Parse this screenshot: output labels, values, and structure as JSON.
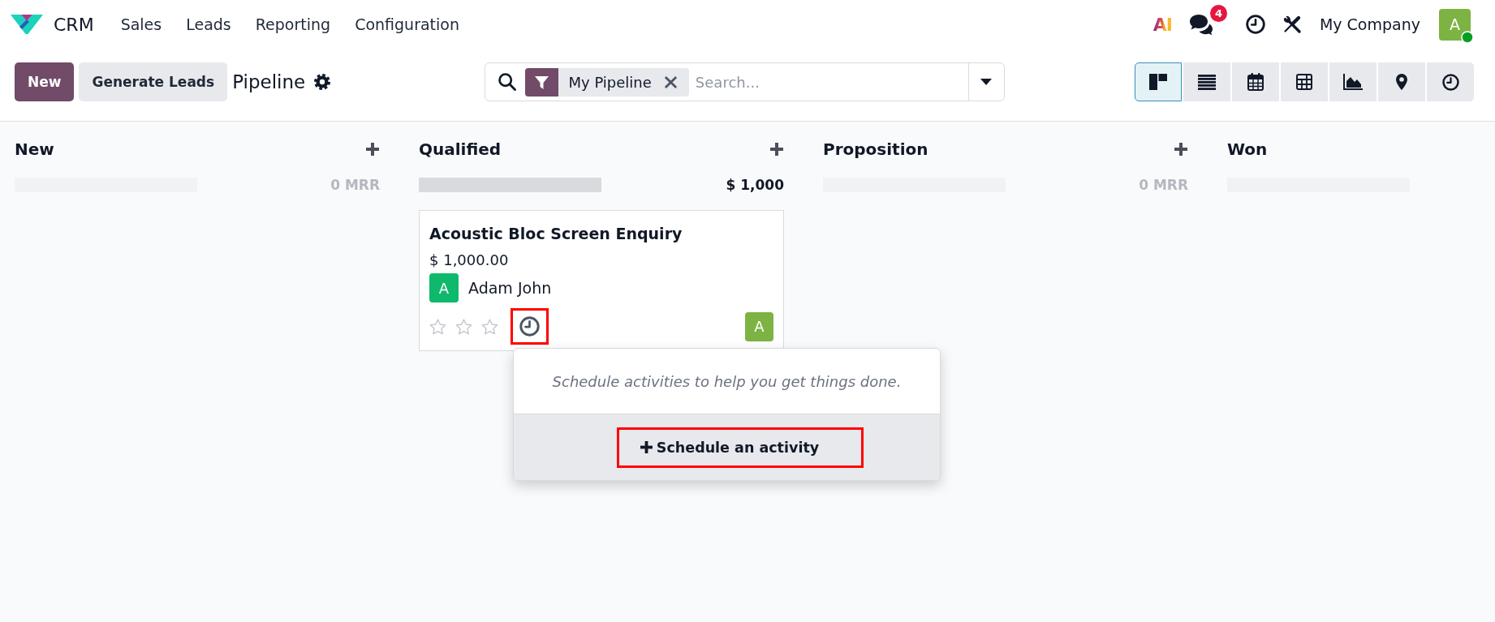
{
  "navbar": {
    "app_name": "CRM",
    "menu": [
      {
        "label": "Sales"
      },
      {
        "label": "Leads"
      },
      {
        "label": "Reporting"
      },
      {
        "label": "Configuration"
      }
    ],
    "ai_label": "AI",
    "message_count": "4",
    "company": "My Company",
    "user_initial": "A",
    "user_online": true
  },
  "control_panel": {
    "buttons": [
      {
        "label": "New",
        "kind": "primary"
      },
      {
        "label": "Generate Leads",
        "kind": "secondary"
      }
    ],
    "title": "Pipeline"
  },
  "search": {
    "facets": [
      {
        "kind": "filter",
        "label": "My Pipeline"
      }
    ],
    "placeholder": "Search..."
  },
  "views": [
    {
      "kind": "kanban",
      "selected": true
    },
    {
      "kind": "list",
      "selected": false
    },
    {
      "kind": "calendar",
      "selected": false
    },
    {
      "kind": "pivot",
      "selected": false
    },
    {
      "kind": "graph",
      "selected": false
    },
    {
      "kind": "map",
      "selected": false
    },
    {
      "kind": "activity",
      "selected": false
    }
  ],
  "columns": [
    {
      "title": "New",
      "add_button": true,
      "empty": true,
      "total": "0 MRR",
      "total_muted": true
    },
    {
      "title": "Qualified",
      "add_button": true,
      "empty": false,
      "total": "$ 1,000",
      "total_muted": false,
      "cards": [
        {
          "title": "Acoustic Bloc Screen Enquiry",
          "amount": "$ 1,000.00",
          "customer": {
            "initial": "A",
            "name": "Adam John"
          },
          "stars": 0,
          "activity_highlighted": true,
          "salesperson_initial": "A"
        }
      ]
    },
    {
      "title": "Proposition",
      "add_button": true,
      "empty": true,
      "total": "0 MRR",
      "total_muted": true
    },
    {
      "title": "Won",
      "add_button": false,
      "empty": true
    }
  ],
  "activity_popover": {
    "message": "Schedule activities to help you get things done.",
    "button": {
      "label": "Schedule an activity",
      "highlighted": true
    }
  }
}
